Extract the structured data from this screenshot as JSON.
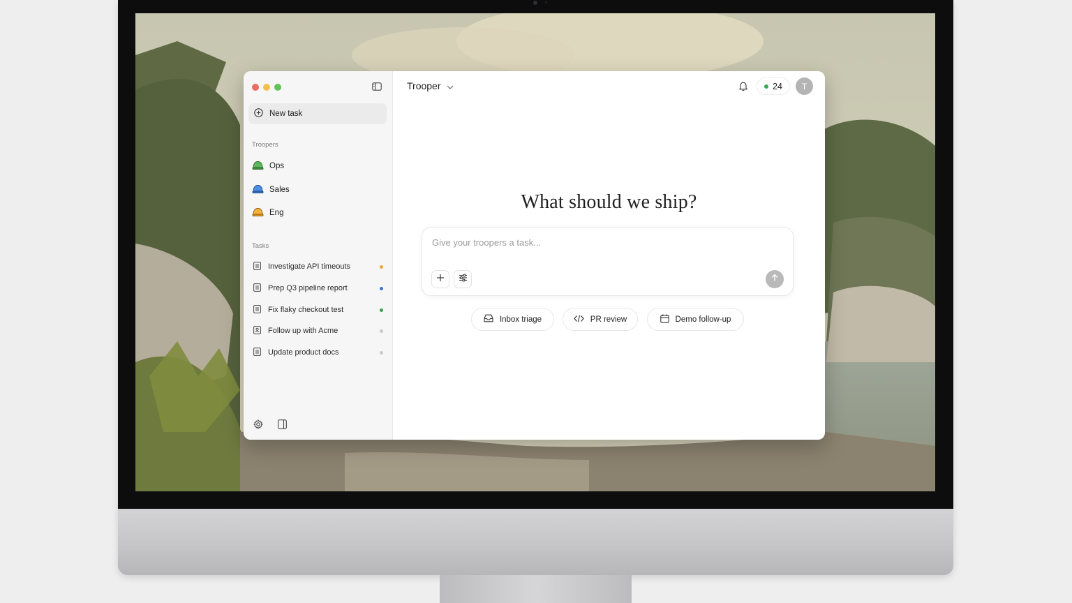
{
  "app": {
    "title": "Trooper",
    "credits": "24",
    "avatar_initial": "T"
  },
  "sidebar": {
    "new_task_label": "New task",
    "troopers_heading": "Troopers",
    "troopers": [
      {
        "label": "Ops",
        "color": "#4caf50"
      },
      {
        "label": "Sales",
        "color": "#3b82f6"
      },
      {
        "label": "Eng",
        "color": "#f59e0b"
      }
    ],
    "tasks_heading": "Tasks",
    "tasks": [
      {
        "label": "Investigate API timeouts",
        "status_color": "#f0a531"
      },
      {
        "label": "Prep Q3 pipeline report",
        "status_color": "#3a72d8"
      },
      {
        "label": "Fix flaky checkout test",
        "status_color": "#3aa14c"
      },
      {
        "label": "Follow up with Acme",
        "status_color": "#c9c9c9"
      },
      {
        "label": "Update product docs",
        "status_color": "#c9c9c9"
      }
    ]
  },
  "main": {
    "headline": "What should we ship?",
    "composer_placeholder": "Give your troopers a task...",
    "suggestions": [
      {
        "label": "Inbox triage",
        "icon": "inbox-icon"
      },
      {
        "label": "PR review",
        "icon": "code-icon"
      },
      {
        "label": "Demo follow-up",
        "icon": "calendar-icon"
      }
    ]
  }
}
